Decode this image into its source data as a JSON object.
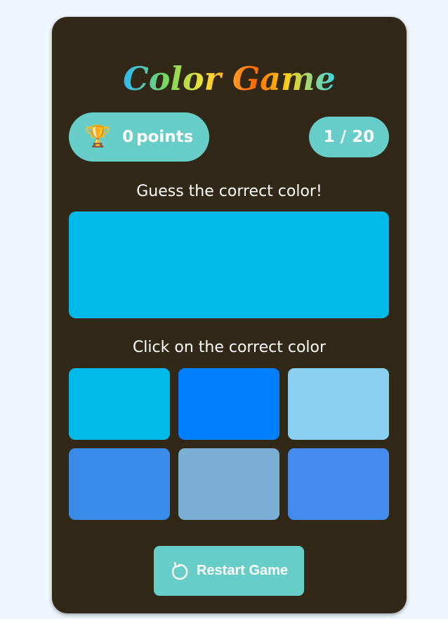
{
  "game": {
    "title": "Color Game",
    "score_icon": "trophy-icon",
    "score_glyph": "🏆",
    "score_value": "0",
    "score_unit": "points",
    "round": "1 / 20",
    "prompt_target": "Guess the correct color!",
    "prompt_options": "Click on the correct color",
    "target_color": "#00b9e8",
    "options": [
      {
        "color": "#00b9e8"
      },
      {
        "color": "#0080ff"
      },
      {
        "color": "#89cff0"
      },
      {
        "color": "#3a8be8"
      },
      {
        "color": "#7aaed4"
      },
      {
        "color": "#458bec"
      }
    ],
    "restart_icon": "restart-icon",
    "restart_label": "Restart Game"
  },
  "colors": {
    "page_background": "#eef5fd",
    "card_background": "#312818",
    "accent": "#66cdc8",
    "text": "#ffffff"
  }
}
